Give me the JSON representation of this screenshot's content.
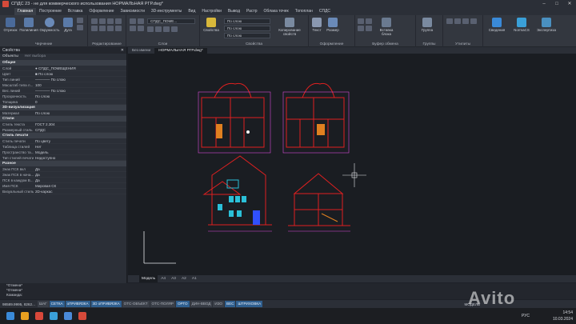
{
  "window": {
    "title": "СПДС 23 - не для коммерческого использования НОРМАЛЬНАЯ РГР.dwg*",
    "controls": [
      "–",
      "□",
      "✕"
    ]
  },
  "ribbon_tabs": [
    "Главная",
    "Построение",
    "Вставка",
    "Оформление",
    "Зависимости",
    "3D-инструменты",
    "Вид",
    "Настройки",
    "Вывод",
    "Растр",
    "Облака точек",
    "Топоплан",
    "СПДС"
  ],
  "ribbon_tabs_active": 0,
  "ribbon": {
    "draw_buttons": [
      "Отрезок",
      "Полилиния",
      "Окружность",
      "Дуга"
    ],
    "group_draw": "Черчение",
    "group_edit": "Редактирование",
    "layer_value": "СПДС_ПОМЕ...",
    "group_layers": "Слои",
    "prop_button": "Свойства",
    "by_layer": "По слою",
    "copy_props": "Копирование свойств",
    "group_props": "Свойства",
    "text_button": "Текст",
    "size_button": "Размер",
    "group_annot": "Оформление",
    "insert_block": "Вставка блока",
    "group_clip": "Буфер обмена",
    "group_button": "Группа",
    "group_groups": "Группы",
    "group_util": "Утилиты",
    "info_button": "Сведения",
    "nanocs_button": "NormaCS",
    "expert_button": "Экспертиза"
  },
  "properties": {
    "header": "Свойства",
    "tabs": [
      "Объекты",
      "Нет выбора"
    ],
    "sections": [
      {
        "title": "Общие",
        "rows": [
          [
            "Слой",
            "● СПДС_ПОМЕЩЕНИЯ"
          ],
          [
            "Цвет",
            "■ По слою"
          ],
          [
            "Тип линий",
            "———— По слою"
          ],
          [
            "Масштаб типа л...",
            "100"
          ],
          [
            "Вес линий",
            "———— По слою"
          ],
          [
            "Прозрачность",
            "По слою"
          ],
          [
            "Толщина",
            "0"
          ]
        ]
      },
      {
        "title": "3D-визуализация",
        "rows": [
          [
            "Материал",
            "По слою"
          ]
        ]
      },
      {
        "title": "Стили",
        "rows": [
          [
            "Стиль текста",
            "ГОСТ 2.304"
          ],
          [
            "Размерный стиль",
            "СПДС"
          ]
        ]
      },
      {
        "title": "Стиль печати",
        "rows": [
          [
            "Стиль печати",
            "По цвету"
          ],
          [
            "Таблица стилей",
            "Нет"
          ],
          [
            "Пространство та...",
            "Модель"
          ],
          [
            "Тип стилей печати",
            "Недоступно"
          ]
        ]
      },
      {
        "title": "Разное",
        "rows": [
          [
            "Знак ПСК вкл",
            "Да"
          ],
          [
            "Знак ПСК в нача...",
            "Да"
          ],
          [
            "ПСК в каждом В...",
            "Да"
          ],
          [
            "Имя ПСК",
            "Мировая СК"
          ],
          [
            "Визуальный стиль",
            "2D-каркас"
          ]
        ]
      }
    ]
  },
  "doc_tabs": [
    "Без имени",
    "НОРМАЛЬНАЯ РГР.dwg*"
  ],
  "layout_tabs": [
    "Модель",
    "А4",
    "А3",
    "А2",
    "А1"
  ],
  "command_lines": [
    "*Отмена*",
    "*Отмена*",
    "Команда:"
  ],
  "statusbar": {
    "coords": "98589.9995, 8262...",
    "toggles": [
      [
        "ШАГ",
        false
      ],
      [
        "СЕТКА",
        true
      ],
      [
        "оПРИВЯЗКА",
        true
      ],
      [
        "3D оПРИВЯЗКА",
        true
      ],
      [
        "ОТС-ОБЪЕКТ",
        false
      ],
      [
        "ОТС-ПОЛЯР",
        false
      ],
      [
        "ОРТО",
        true
      ],
      [
        "ДИН-ВВОД",
        false
      ],
      [
        "ИЗО",
        false
      ],
      [
        "ВЕС",
        true
      ],
      [
        "ШТРИХОВКА",
        true
      ]
    ],
    "model": "МОДЕЛЬ"
  },
  "tray": {
    "lang": "РУС",
    "time": "14:54",
    "date": "10.03.2024"
  },
  "watermark": "Avito",
  "colors": {
    "drawing_red": "#e02020",
    "cyan": "#2bc0d8",
    "magenta": "#d84cd8",
    "blue": "#3050ff",
    "accent": "#2f5f8f"
  }
}
